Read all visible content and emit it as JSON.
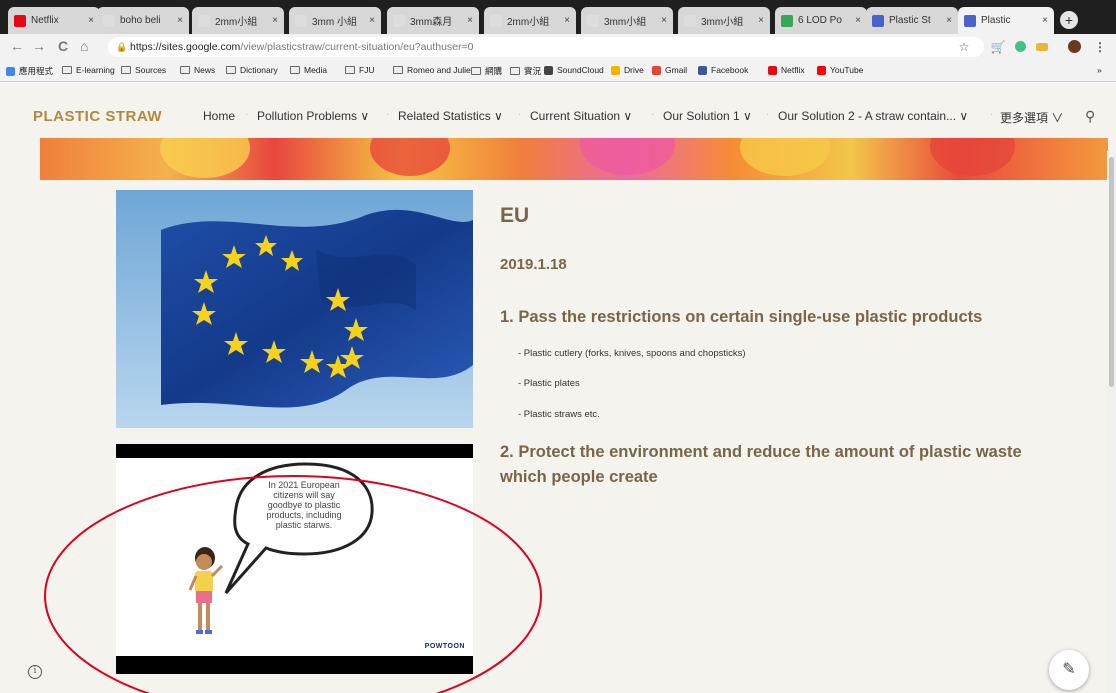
{
  "browser": {
    "tabs": [
      {
        "title": "Netflix",
        "color": "#e50914",
        "active": false
      },
      {
        "title": "boho beli",
        "color": "#dddddd",
        "active": false
      },
      {
        "title": "2mm小組",
        "color": "#dddddd",
        "active": false
      },
      {
        "title": "3mm 小組",
        "color": "#dddddd",
        "active": false
      },
      {
        "title": "3mm森月",
        "color": "#dddddd",
        "active": false
      },
      {
        "title": "2mm小組",
        "color": "#dddddd",
        "active": false
      },
      {
        "title": "3mm小組",
        "color": "#dddddd",
        "active": false
      },
      {
        "title": "3mm小組",
        "color": "#dddddd",
        "active": false
      },
      {
        "title": "6 LOD Po",
        "color": "#34a853",
        "active": false
      },
      {
        "title": "Plastic St",
        "color": "#4863c9",
        "active": false
      },
      {
        "title": "Plastic",
        "color": "#4863c9",
        "active": true
      }
    ],
    "new_tab_label": "+",
    "nav": {
      "back": "←",
      "forward": "→",
      "reload": "C",
      "home": "⌂"
    },
    "url": "https://sites.google.com/view/plasticstraw/current-situation/eu?authuser=0",
    "url_host": "https://sites.google.com",
    "url_path": "/view/plasticstraw/current-situation/eu?authuser=0",
    "toolbar_icons": [
      "star-icon",
      "cart-icon",
      "extension-icon",
      "drive-icon",
      "avatar",
      "menu-icon"
    ],
    "bookmarks": [
      {
        "label": "應用程式",
        "kind": "apps"
      },
      {
        "label": "E-learning",
        "kind": "folder"
      },
      {
        "label": "Sources",
        "kind": "folder"
      },
      {
        "label": "News",
        "kind": "folder"
      },
      {
        "label": "Dictionary",
        "kind": "folder"
      },
      {
        "label": "Media",
        "kind": "folder"
      },
      {
        "label": "FJU",
        "kind": "folder"
      },
      {
        "label": "Romeo and Juliet",
        "kind": "folder"
      },
      {
        "label": "網購",
        "kind": "folder"
      },
      {
        "label": "實況",
        "kind": "folder"
      },
      {
        "label": "SoundCloud",
        "kind": "site"
      },
      {
        "label": "Drive",
        "kind": "site"
      },
      {
        "label": "Gmail",
        "kind": "site"
      },
      {
        "label": "Facebook",
        "kind": "site"
      },
      {
        "label": "Netflix",
        "kind": "site"
      },
      {
        "label": "YouTube",
        "kind": "site"
      }
    ],
    "bookmarks_overflow": "»"
  },
  "site": {
    "brand": "PLASTIC STRAW",
    "nav": [
      {
        "label": "Home"
      },
      {
        "label": "Pollution Problems ∨"
      },
      {
        "label": "Related Statistics ∨"
      },
      {
        "label": "Current Situation ∨"
      },
      {
        "label": "Our Solution 1 ∨"
      },
      {
        "label": "Our Solution 2 - A straw contain... ∨"
      },
      {
        "label": "更多選項 ∨"
      }
    ]
  },
  "main": {
    "title": "EU",
    "date": "2019.1.18",
    "point1": "1. Pass the restrictions on certain single-use plastic products",
    "bullets": [
      "- Plastic cutlery (forks, knives, spoons and chopsticks)",
      "- Plastic plates",
      "- Plastic straws etc."
    ],
    "point2": "2. Protect the environment and reduce the amount of plastic waste which people create"
  },
  "video": {
    "speech": "In 2021 European citizens will say goodbye to plastic products, including plastic starws.",
    "logo": "POWTOON"
  },
  "colors": {
    "brand": "#b08a3e",
    "heading": "#7b6548",
    "page_bg": "#f5f3ee",
    "annotation": "#e0001b"
  }
}
